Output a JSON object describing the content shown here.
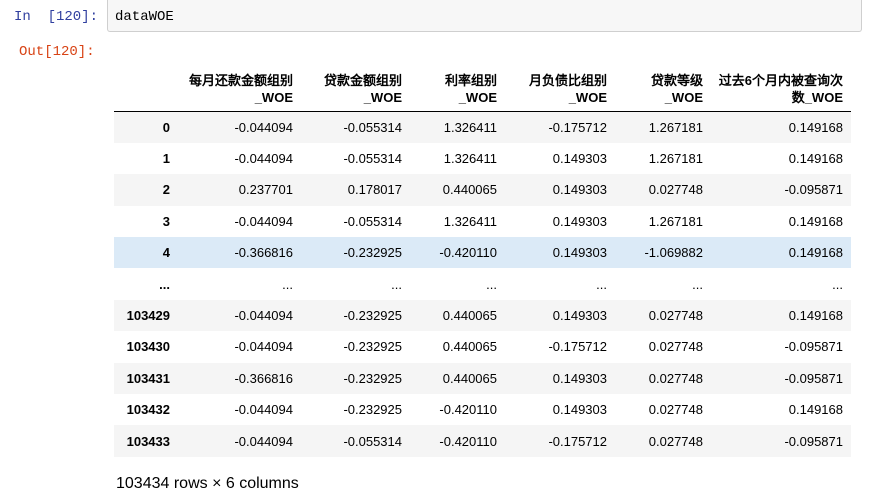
{
  "notebook": {
    "input_prompt": "In  [120]:",
    "output_prompt": "Out[120]:",
    "code": "dataWOE"
  },
  "dataframe": {
    "columns": [
      "",
      "每月还款金额组别_WOE",
      "贷款金额组别_WOE",
      "利率组别_WOE",
      "月负债比组别_WOE",
      "贷款等级_WOE",
      "过去6个月内被查询次数_WOE"
    ],
    "rows": [
      {
        "index": "0",
        "values": [
          "-0.044094",
          "-0.055314",
          "1.326411",
          "-0.175712",
          "1.267181",
          "0.149168"
        ]
      },
      {
        "index": "1",
        "values": [
          "-0.044094",
          "-0.055314",
          "1.326411",
          "0.149303",
          "1.267181",
          "0.149168"
        ]
      },
      {
        "index": "2",
        "values": [
          "0.237701",
          "0.178017",
          "0.440065",
          "0.149303",
          "0.027748",
          "-0.095871"
        ]
      },
      {
        "index": "3",
        "values": [
          "-0.044094",
          "-0.055314",
          "1.326411",
          "0.149303",
          "1.267181",
          "0.149168"
        ]
      },
      {
        "index": "4",
        "values": [
          "-0.366816",
          "-0.232925",
          "-0.420110",
          "0.149303",
          "-1.069882",
          "0.149168"
        ]
      },
      {
        "index": "...",
        "values": [
          "...",
          "...",
          "...",
          "...",
          "...",
          "..."
        ]
      },
      {
        "index": "103429",
        "values": [
          "-0.044094",
          "-0.232925",
          "0.440065",
          "0.149303",
          "0.027748",
          "0.149168"
        ]
      },
      {
        "index": "103430",
        "values": [
          "-0.044094",
          "-0.232925",
          "0.440065",
          "-0.175712",
          "0.027748",
          "-0.095871"
        ]
      },
      {
        "index": "103431",
        "values": [
          "-0.366816",
          "-0.232925",
          "0.440065",
          "0.149303",
          "0.027748",
          "-0.095871"
        ]
      },
      {
        "index": "103432",
        "values": [
          "-0.044094",
          "-0.232925",
          "-0.420110",
          "0.149303",
          "0.027748",
          "0.149168"
        ]
      },
      {
        "index": "103433",
        "values": [
          "-0.044094",
          "-0.055314",
          "-0.420110",
          "-0.175712",
          "0.027748",
          "-0.095871"
        ]
      }
    ],
    "shape_text": "103434 rows × 6 columns"
  }
}
